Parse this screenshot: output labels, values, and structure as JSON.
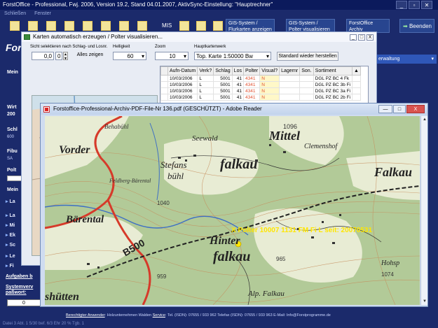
{
  "app": {
    "title": "ForstOffice - Professional, Fwj. 2006, Version 19.2, Stand 04.01.2007, AktivSync-Einstellung: \"Hauptrechner\"",
    "menu": [
      "Schließen",
      "Fenster"
    ],
    "ctl_min": "_",
    "ctl_max": "▫",
    "ctl_close": "✕"
  },
  "toolbar": {
    "mis": "MIS",
    "gis1_line1": "GIS-System /",
    "gis1_line2": "Flurkarten anzeigen",
    "gis2_line1": "GIS-System /",
    "gis2_line2": "Polter visualisieren",
    "forst_line1": "ForstOffice",
    "forst_line2": "Archiv",
    "beenden": "Beenden"
  },
  "left_panel": {
    "logo": "Fors",
    "verwaltung": "erwaltung",
    "aufgaben": "Aufgaben b",
    "system_line1": "Systemverv",
    "system_line2": "paßwort:",
    "input_value": "0"
  },
  "karten": {
    "title": "Karten automatisch erzeugen / Polter visualisieren...",
    "ctl_min": "_",
    "ctl_max": "□",
    "ctl_close": "X",
    "sicht_label": "Sicht selektieren nach Schlag- und Losnr.",
    "sicht_value": "0,0",
    "spin_value": "0",
    "alles": "Alles zeigen",
    "helligkeit_label": "Helligkeit",
    "helligkeit_value": "60",
    "zoom_label": "Zoom",
    "zoom_value": "10",
    "haupt_label": "Hauptkartenwerk",
    "haupt_value": "Top. Karte 1:50000 Bw",
    "standard": "Standard wieder herstellen",
    "columns": [
      "Aufn-Datum",
      "Verk?",
      "Schlag",
      "Los",
      "Polter",
      "Visual?",
      "Lagernr",
      "Son.",
      "Sortiment"
    ],
    "rows": [
      [
        "10/03/2006",
        "L",
        "5001",
        "41",
        "4341",
        "N",
        "",
        "",
        "DGL PZ  BC  4  Fk"
      ],
      [
        "10/03/2006",
        "L",
        "5001",
        "41",
        "4341",
        "N",
        "",
        "",
        "DGL PZ  BC  3b  Fi"
      ],
      [
        "10/03/2006",
        "L",
        "5001",
        "41",
        "4341",
        "N",
        "",
        "",
        "DGL PZ  BC  3a  Fi"
      ],
      [
        "10/03/2006",
        "L",
        "5001",
        "41",
        "4341",
        "N",
        "",
        "",
        "DGL PZ  BC  2b  Fi"
      ]
    ]
  },
  "pdf": {
    "title": "Forstoffice-Professional-Archiv-PDF-File-Nr 136.pdf (GESCHÜTZT) - Adobe Reader",
    "ctl_min": "—",
    "ctl_max": "□",
    "ctl_close": "X",
    "map_labels": {
      "vorder": "Vorder",
      "seewald": "Seewald",
      "mittel": "Mittel",
      "falkau": "falkau",
      "clemenshof": "Clemenshof",
      "falkau_right": "Falkau",
      "stefans": "Stefans",
      "buhl": "bühl",
      "feldberg": "Feldberg-Bärental",
      "barental": "Bärental",
      "hinter": "Hinter",
      "falkau_bottom": "falkau",
      "b500": "B500",
      "hohspi": "Hohsp",
      "schutten": "shütten",
      "alpfalkau": "Alp. Falkau",
      "marker": "X Polter 10007 1131 FM Fi L   seit: 20070531",
      "n1096": "1096",
      "n1040": "1040",
      "n965": "965",
      "n959": "959",
      "n1074": "1074"
    },
    "scroll_up": "▲",
    "scroll_down": "▼"
  },
  "footer": {
    "berechtigter": "Berechtigter Anwender",
    "holz": ": Holzunternehmen Walden",
    "service": "Service",
    "contact": ":  Tel. (ISDN): 07655 / 933 962  Telefax (ISDN): 07655 / 933 963   E-Mail: Info@Forstprogramme.de"
  },
  "taskbar": {
    "text": "Datei 3    Abt. 1    5/30    bef. 6/3 Ehr    20 %    Tgb. 1"
  },
  "colors": {
    "app_bg": "#1b2a6b",
    "highlight_red": "#e05030",
    "marker_yellow": "#ffe600"
  }
}
